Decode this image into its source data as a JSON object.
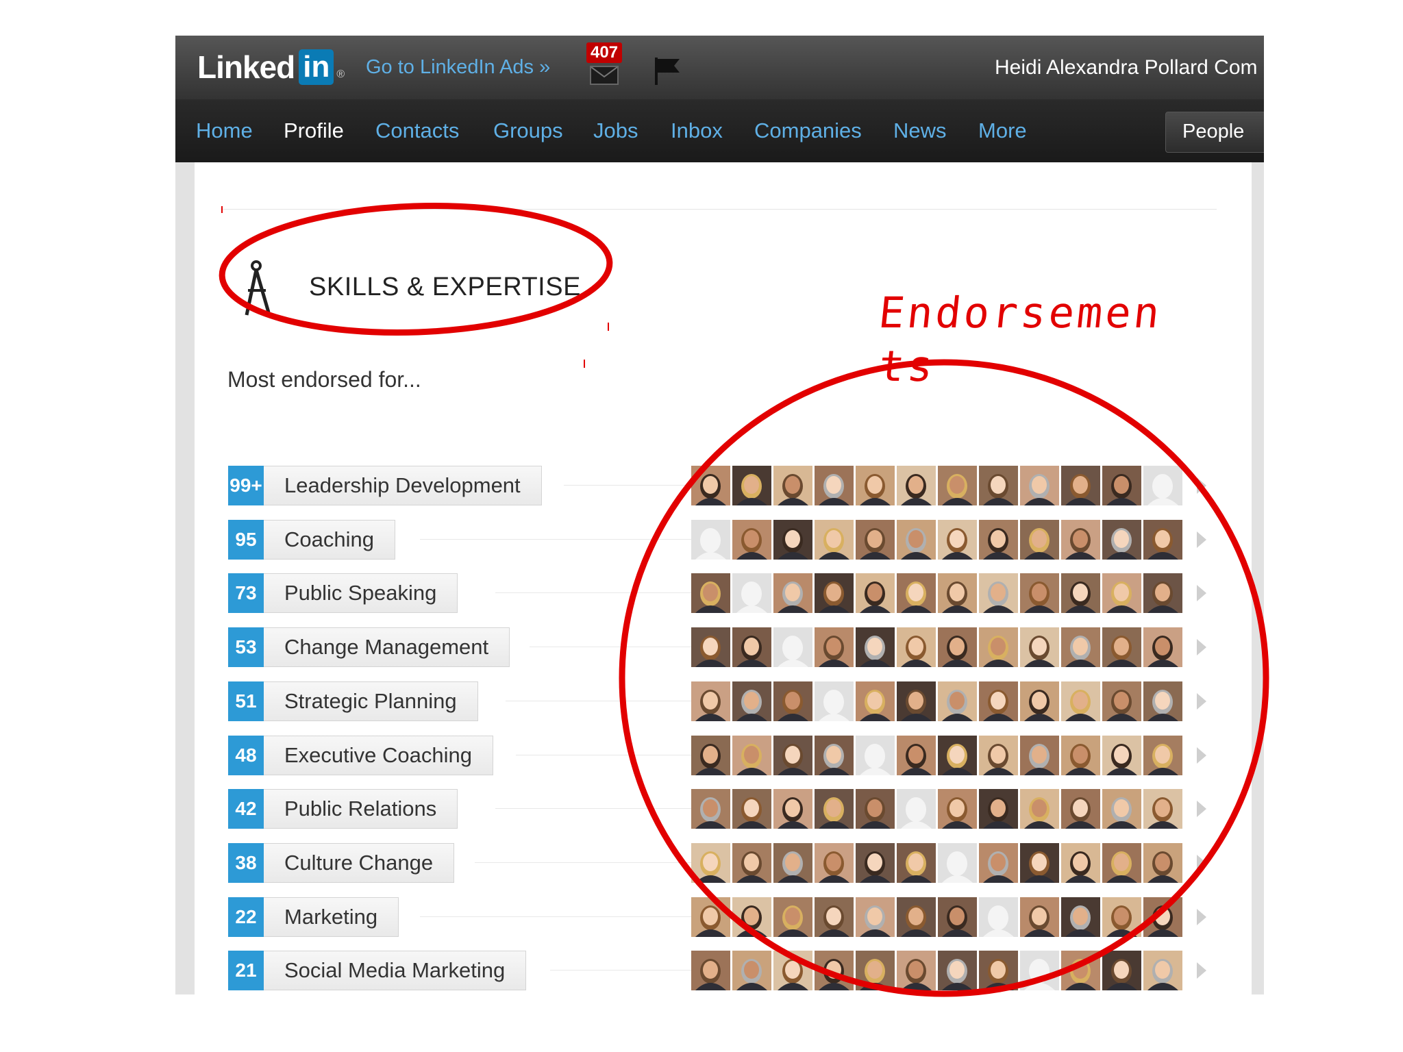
{
  "header": {
    "logo_text": "Linked",
    "logo_in": "in",
    "logo_reg": "®",
    "ads_link": "Go to LinkedIn Ads »",
    "mail_count": "407",
    "user_name": "Heidi Alexandra Pollard Com"
  },
  "nav": {
    "items": [
      "Home",
      "Profile",
      "Contacts",
      "Groups",
      "Jobs",
      "Inbox",
      "Companies",
      "News",
      "More"
    ],
    "active": "Profile",
    "search_scope": "People"
  },
  "section": {
    "title": "SKILLS & EXPERTISE",
    "subtitle": "Most endorsed for..."
  },
  "skills": [
    {
      "count": "99+",
      "name": "Leadership Development"
    },
    {
      "count": "95",
      "name": "Coaching"
    },
    {
      "count": "73",
      "name": "Public Speaking"
    },
    {
      "count": "53",
      "name": "Change Management"
    },
    {
      "count": "51",
      "name": "Strategic Planning"
    },
    {
      "count": "48",
      "name": "Executive Coaching"
    },
    {
      "count": "42",
      "name": "Public Relations"
    },
    {
      "count": "38",
      "name": "Culture Change"
    },
    {
      "count": "22",
      "name": "Marketing"
    },
    {
      "count": "21",
      "name": "Social Media Marketing"
    }
  ],
  "annotation": {
    "line1": "Endorsemen",
    "line2": "ts",
    "color": "#e20000"
  },
  "colors": {
    "accent": "#2d9ad6",
    "nav_link": "#5fb0e6",
    "brand": "#0a7bb5"
  }
}
